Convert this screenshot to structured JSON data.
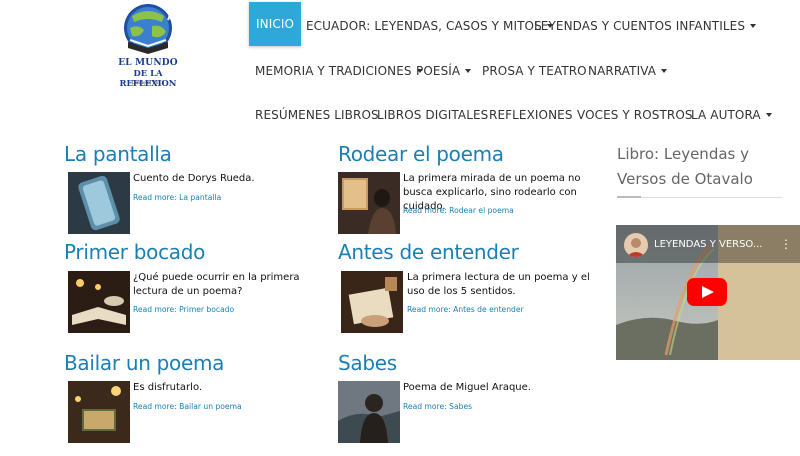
{
  "logo": {
    "line1": "EL MUNDO",
    "line2": "DE LA REFLEXION",
    "line3": "Desde el 2013"
  },
  "nav": {
    "row1": [
      {
        "label": "INICIO",
        "active": true,
        "dropdown": false
      },
      {
        "label": "ECUADOR: LEYENDAS, CASOS Y MITOS",
        "dropdown": true
      },
      {
        "label": "LEYENDAS Y CUENTOS INFANTILES",
        "dropdown": true
      }
    ],
    "row2": [
      {
        "label": "MEMORIA Y TRADICIONES",
        "dropdown": true
      },
      {
        "label": "POESÍA",
        "dropdown": true
      },
      {
        "label": "PROSA Y TEATRO",
        "dropdown": false
      },
      {
        "label": "NARRATIVA",
        "dropdown": true
      }
    ],
    "row3": [
      {
        "label": "RESÚMENES LIBROS",
        "dropdown": false
      },
      {
        "label": "LIBROS DIGITALES",
        "dropdown": false
      },
      {
        "label": "REFLEXIONES",
        "dropdown": false
      },
      {
        "label": "VOCES Y ROSTROS",
        "dropdown": false
      },
      {
        "label": "LA AUTORA",
        "dropdown": true
      }
    ]
  },
  "articles": [
    {
      "title": "La pantalla",
      "excerpt": "Cuento de Dorys Rueda.",
      "read_more": "Read more:",
      "link": "La pantalla"
    },
    {
      "title": "Rodear el poema",
      "excerpt": "La primera mirada de un poema no busca explicarlo, sino rodearlo con cuidado.",
      "read_more": "Read more:",
      "link": "Rodear el poema"
    },
    {
      "title": "Primer bocado",
      "excerpt": "¿Qué puede ocurrir en la primera lectura de un poema?",
      "read_more": "Read more:",
      "link": "Primer bocado"
    },
    {
      "title": "Antes de entender",
      "excerpt": "La primera lectura de un poema y el uso de los 5 sentidos.",
      "read_more": "Read more:",
      "link": "Antes de entender"
    },
    {
      "title": "Bailar un poema",
      "excerpt": "Es disfrutarlo.",
      "read_more": "Read more:",
      "link": "Bailar un poema"
    },
    {
      "title": "Sabes",
      "excerpt": "Poema de Miguel Araque.",
      "read_more": "Read more:",
      "link": "Sabes"
    }
  ],
  "sidebar": {
    "title": "Libro: Leyendas y Versos de Otavalo",
    "video_title": "LEYENDAS Y VERSO...",
    "video_menu": "⋮"
  },
  "colors": {
    "accent": "#2ea8d8",
    "title": "#1a7fb5",
    "youtube_red": "#ff0000"
  }
}
